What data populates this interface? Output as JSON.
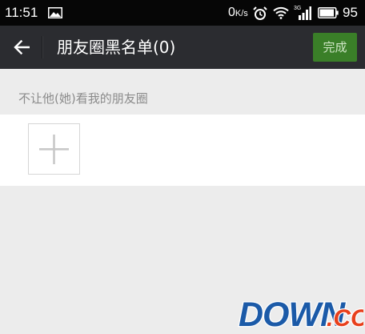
{
  "status_bar": {
    "time": "11:51",
    "image_icon": "image-icon",
    "net_speed": "0",
    "net_speed_unit": "K/s",
    "alarm_icon": "alarm-clock-icon",
    "wifi_icon": "wifi-icon",
    "signal_icon": "signal-3g-icon",
    "signal_label": "3G",
    "battery_icon": "battery-icon",
    "battery_level": 0.95,
    "battery_percent": "95"
  },
  "header": {
    "back_icon": "back-arrow-icon",
    "title": "朋友圈黑名单(0)",
    "done_label": "完成"
  },
  "main": {
    "section_label": "不让他(她)看我的朋友圈",
    "add_icon": "plus-icon"
  },
  "watermark": {
    "text_main": "DOWN",
    "text_suffix": ".CC"
  },
  "colors": {
    "status_bar_bg": "#060606",
    "title_bar_bg": "#2b2c30",
    "done_button_bg": "#3a7f28",
    "page_bg": "#ececec",
    "panel_bg": "#ffffff"
  }
}
